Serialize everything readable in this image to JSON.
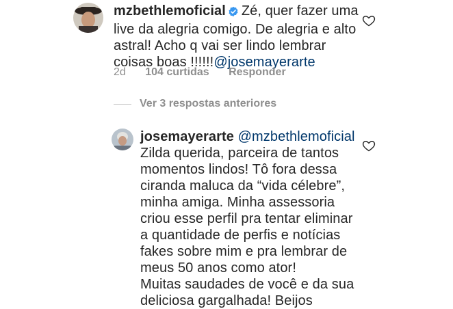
{
  "comment1": {
    "username": "mzbethlemoficial",
    "text_line1": "Zé, quer fazer uma",
    "text_line2": "live da alegria comigo. De alegria e alto",
    "text_line3": "astral! Acho q vai ser lindo lembrar",
    "text_line4_prefix": "coisas boas !!!!!!",
    "mention": "@josemayerarte",
    "time": "2d",
    "likes": "104 curtidas",
    "reply": "Responder"
  },
  "view_replies": "Ver 3 respostas anteriores",
  "comment2": {
    "username": "josemayerarte",
    "mention": "@mzbethlemoficial",
    "lines": [
      "Zilda querida, parceira de tantos",
      "momentos lindos! Tô fora dessa",
      "ciranda maluca da “vida célebre”,",
      "minha amiga. Minha assessoria",
      "criou esse perfil pra tentar eliminar",
      "a quantidade de perfis e notícias",
      "fakes sobre mim e pra lembrar de",
      "meus 50 anos como ator!",
      "Muitas saudades de você e da sua",
      "deliciosa gargalhada! Beijos"
    ]
  },
  "colors": {
    "verified": "#3897f0",
    "mention": "#00376b",
    "meta": "#8e8e8e"
  },
  "icons": {
    "heart": "heart-icon",
    "verified": "verified-badge-icon"
  }
}
